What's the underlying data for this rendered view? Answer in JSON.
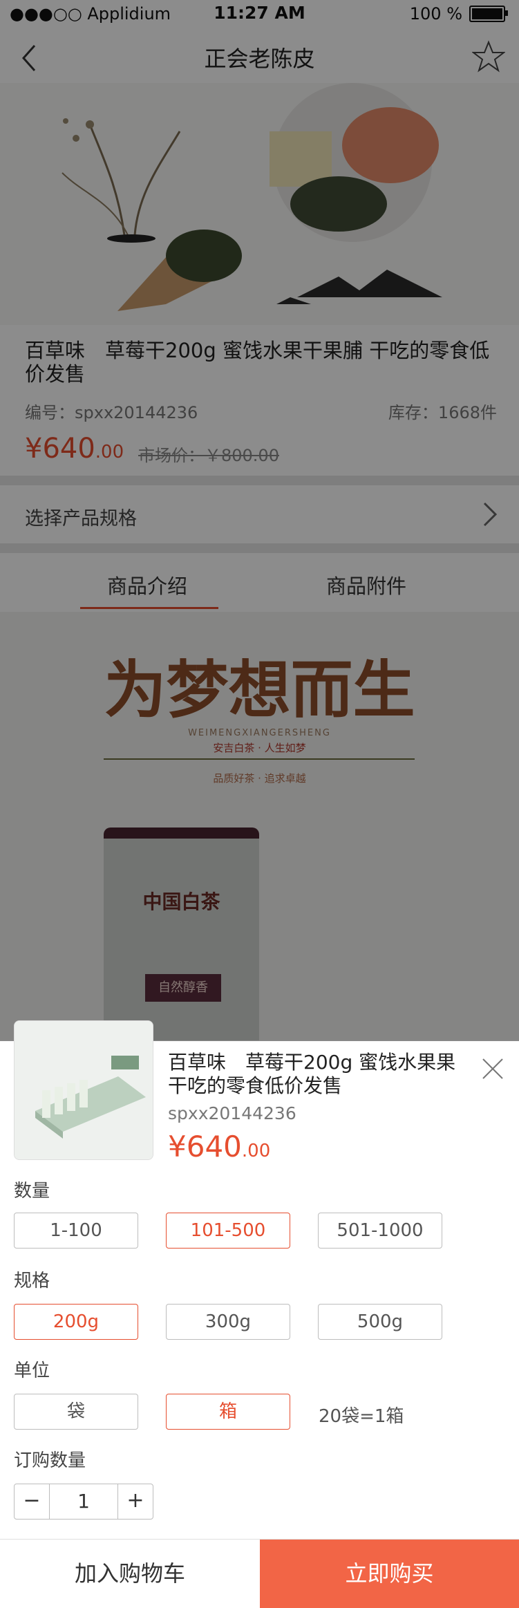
{
  "status": {
    "carrier": "●●●○○ Applidium",
    "time": "11:27 AM",
    "battery": "100 %"
  },
  "nav": {
    "title": "正会老陈皮",
    "back_icon": "chevron-left-icon",
    "fav_icon": "star-icon"
  },
  "product": {
    "title": "百草味　草莓干200g  蜜饯水果干果脯  干吃的零食低价发售",
    "code": "编号：spxx20144236",
    "stock": "库存：1668件",
    "price_int": "¥640",
    "price_dec": ".00",
    "market_price": "市场价：￥800.00"
  },
  "spec_select_label": "选择产品规格",
  "tabs": [
    "商品介绍",
    "商品附件"
  ],
  "banner": {
    "headline": "为梦想而生",
    "sub_en": "WEIMENGXIANGERSHENG",
    "sub_cn": "安吉白茶 · 人生如梦",
    "tagline": "品质好茶 · 追求卓越",
    "can_logo": "中国白茶",
    "can_label": "自然醇香"
  },
  "sheet": {
    "title": "百草味　草莓干200g  蜜饯水果果干吃的零食低价发售",
    "code": "spxx20144236",
    "price_int": "¥640",
    "price_dec": ".00",
    "groups": {
      "quantity": {
        "label": "数量",
        "options": [
          "1-100",
          "101-500",
          "501-1000"
        ],
        "selected": "101-500"
      },
      "spec": {
        "label": "规格",
        "options": [
          "200g",
          "300g",
          "500g"
        ],
        "selected": "200g"
      },
      "unit": {
        "label": "单位",
        "options": [
          "袋",
          "箱"
        ],
        "selected": "箱",
        "note": "20袋=1箱"
      },
      "order": {
        "label": "订购数量",
        "value": "1",
        "minus": "−",
        "plus": "+"
      }
    },
    "add_to_cart": "加入购物车",
    "buy_now": "立即购买"
  },
  "colors": {
    "accent": "#e64e2f",
    "buy_bg": "#f26546"
  }
}
